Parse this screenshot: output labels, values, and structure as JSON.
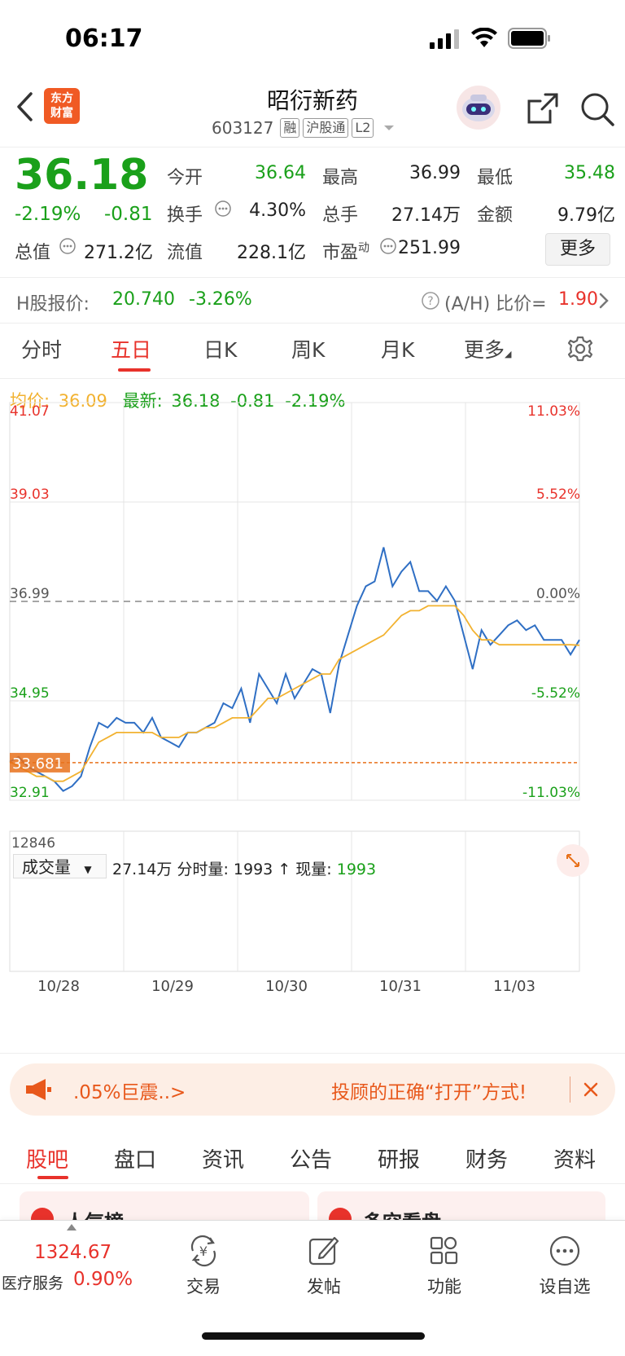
{
  "status_bar": {
    "time": "06:17"
  },
  "header": {
    "logo_line1": "东方",
    "logo_line2": "财富",
    "stock_name": "昭衍新药",
    "stock_code": "603127",
    "tags": [
      "融",
      "沪股通",
      "L2"
    ]
  },
  "quote": {
    "price": "36.18",
    "change_pct": "-2.19%",
    "change_val": "-0.81",
    "rows": [
      [
        {
          "label": "今开",
          "value": "36.64"
        },
        {
          "label": "最高",
          "value": "36.99"
        },
        {
          "label": "最低",
          "value": "35.48"
        }
      ],
      [
        {
          "label": "换手",
          "value": "4.30%"
        },
        {
          "label": "总手",
          "value": "27.14万"
        },
        {
          "label": "金额",
          "value": "9.79亿"
        }
      ],
      [
        {
          "label": "总值",
          "value": "271.2亿"
        },
        {
          "label": "流值",
          "value": "228.1亿"
        },
        {
          "label": "市盈",
          "label_sup": "动",
          "value": "251.99"
        }
      ]
    ],
    "more_label": "更多"
  },
  "h_share": {
    "label": "H股报价:",
    "price": "20.740",
    "pct": "-3.26%",
    "ratio_label": "(A/H) 比价=",
    "ratio_value": "1.90"
  },
  "period_tabs": [
    {
      "label": "分时",
      "active": false
    },
    {
      "label": "五日",
      "active": true
    },
    {
      "label": "日K",
      "active": false
    },
    {
      "label": "周K",
      "active": false
    },
    {
      "label": "月K",
      "active": false
    },
    {
      "label": "更多",
      "active": false
    }
  ],
  "chart_info": {
    "avg_label": "均价:",
    "avg_value": "36.09",
    "last_label": "最新:",
    "last_value": "36.18",
    "last_change": "-0.81",
    "last_pct": "-2.19%"
  },
  "chart_data": {
    "type": "line",
    "y_left_ticks": [
      "41.07",
      "39.03",
      "36.99",
      "34.95",
      "32.91"
    ],
    "y_right_ticks": [
      "11.03%",
      "5.52%",
      "0.00%",
      "-5.52%",
      "-11.03%"
    ],
    "ylim": [
      32.91,
      41.07
    ],
    "prev_close": 36.99,
    "marker_line_label": "33.681",
    "x_labels": [
      "10/28",
      "10/29",
      "10/30",
      "10/31",
      "11/03"
    ],
    "series": [
      {
        "values": [
          33.7,
          33.8,
          33.6,
          33.5,
          33.4,
          33.3,
          33.1,
          33.2,
          33.4,
          34.0,
          34.5,
          34.4,
          34.6,
          34.5,
          34.5,
          34.3,
          34.6,
          34.2,
          34.1,
          34.0,
          34.3,
          34.3,
          34.4,
          34.5,
          34.9,
          34.8,
          35.2,
          34.5,
          35.5,
          35.2,
          34.9,
          35.5,
          35.0,
          35.3,
          35.6,
          35.5,
          34.7,
          35.7,
          36.3,
          36.9,
          37.3,
          37.4,
          38.1,
          37.3,
          37.6,
          37.8,
          37.2,
          37.2,
          37.0,
          37.3,
          37.0,
          36.3,
          35.6,
          36.4,
          36.1,
          36.3,
          36.5,
          36.6,
          36.4,
          36.5,
          36.2,
          36.2,
          36.2,
          35.9,
          36.2
        ]
      },
      {
        "values": [
          33.7,
          33.6,
          33.5,
          33.4,
          33.4,
          33.3,
          33.3,
          33.4,
          33.5,
          33.8,
          34.1,
          34.2,
          34.3,
          34.3,
          34.3,
          34.3,
          34.3,
          34.2,
          34.2,
          34.2,
          34.3,
          34.3,
          34.4,
          34.4,
          34.5,
          34.6,
          34.6,
          34.6,
          34.8,
          35.0,
          35.0,
          35.1,
          35.2,
          35.3,
          35.4,
          35.5,
          35.5,
          35.8,
          35.9,
          36.0,
          36.1,
          36.2,
          36.3,
          36.5,
          36.7,
          36.8,
          36.8,
          36.9,
          36.9,
          36.9,
          36.9,
          36.7,
          36.4,
          36.2,
          36.2,
          36.1,
          36.1,
          36.1,
          36.1,
          36.1,
          36.1,
          36.1,
          36.1,
          36.1,
          36.09
        ]
      }
    ],
    "volume": {
      "label": "成交量",
      "total": "27.14万",
      "fenshi_label": "分时量:",
      "fenshi_value": "1993",
      "xianliang_label": "现量:",
      "xianliang_value": "1993",
      "max_label": "12846"
    }
  },
  "banner": {
    "left_text": ".05%巨震..>",
    "right_text": "投顾的正确“打开”方式!"
  },
  "bottom_tabs": [
    "股吧",
    "盘口",
    "资讯",
    "公告",
    "研报",
    "财务",
    "资料"
  ],
  "card_partial": {
    "left": "人气榜",
    "right": "多空看盘"
  },
  "bottom_nav": {
    "index_value": "1324.67",
    "index_name": "医疗服务",
    "index_pct": "0.90%",
    "items": [
      "交易",
      "发帖",
      "功能",
      "设自选"
    ]
  },
  "colors": {
    "red": "#e8322b",
    "green": "#1aa01a",
    "orange": "#e8711b",
    "blue": "#2f6fc4",
    "avg_line": "#f2b230"
  }
}
